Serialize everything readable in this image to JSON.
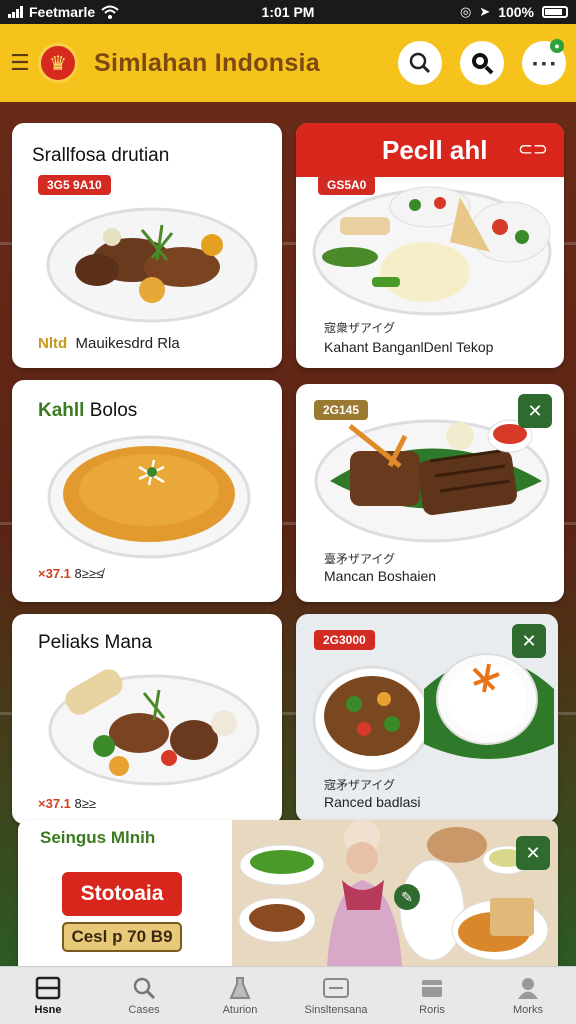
{
  "status_bar": {
    "carrier": "Feetmarle",
    "time": "1:01 PM",
    "battery": "100%"
  },
  "header": {
    "title": "Simlahan Indonsia"
  },
  "cards": {
    "c1": {
      "title": "Srallfosa drutian",
      "badge": "3G5 9A10",
      "highlight": "Nltd",
      "meta": "Mauikesdrd Rla"
    },
    "c2": {
      "title_green": "Kahll",
      "title_rest": "Bolos",
      "rating": "×37.1",
      "meta": "8≥≥≰"
    },
    "c3": {
      "title": "Peliaks Mana",
      "rating": "×37.1",
      "meta": "8≥≥"
    },
    "f1": {
      "header": "Pecll ahl",
      "header_icon": "⊂⊃",
      "badge": "GS5A0",
      "jp": "宼衆ザアイグ",
      "meta": "Kahant BanganlDenl Tekop"
    },
    "f2": {
      "badge": "2G145",
      "jp": "臺矛ザアイグ",
      "meta": "Mancan Boshaien"
    },
    "f3": {
      "badge": "2G3000",
      "jp": "宼矛ザアイグ",
      "meta": "Ranced badlasi"
    }
  },
  "promo": {
    "title": "Seingus Mlnih",
    "button": "Stotoaia",
    "price_button": "Cesl p 70 B9"
  },
  "nav": [
    {
      "label": "Hsne",
      "icon": "home-icon"
    },
    {
      "label": "Cases",
      "icon": "search-icon"
    },
    {
      "label": "Aturion",
      "icon": "flask-icon"
    },
    {
      "label": "Sinsltensana",
      "icon": "card-icon"
    },
    {
      "label": "Roris",
      "icon": "box-icon"
    },
    {
      "label": "Morks",
      "icon": "person-icon"
    }
  ],
  "colors": {
    "brand_yellow": "#f6c21c",
    "brand_red": "#d9261d",
    "accent_green": "#2f6a2f"
  }
}
